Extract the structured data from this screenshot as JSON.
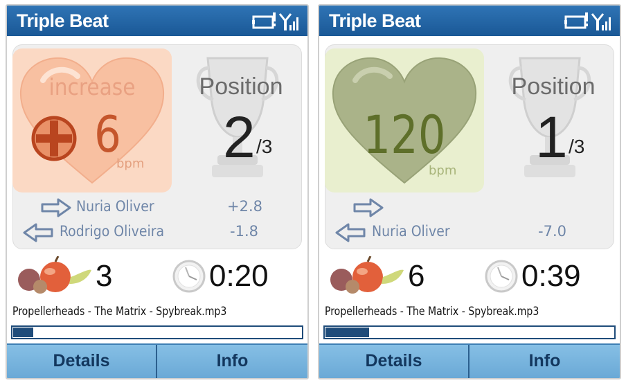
{
  "screens": [
    {
      "app_title": "Triple Beat",
      "heart": {
        "mode": "increase",
        "label": "increase",
        "value": "6",
        "unit": "bpm",
        "fill_color": "#fbd9c4"
      },
      "position": {
        "label": "Position",
        "current": "2",
        "of": "/3"
      },
      "competitors": [
        {
          "direction": "ahead",
          "name": "Nuria Oliver",
          "diff": "+2.8"
        },
        {
          "direction": "behind",
          "name": "Rodrigo Oliveira",
          "diff": "-1.8"
        }
      ],
      "fruit_count": "3",
      "elapsed_time": "0:20",
      "track_title": "Propellerheads - The Matrix - Spybreak.mp3",
      "progress_fraction": 0.07,
      "softkeys": {
        "left": "Details",
        "right": "Info"
      }
    },
    {
      "app_title": "Triple Beat",
      "heart": {
        "mode": "heart-rate",
        "label": "",
        "value": "120",
        "unit": "bpm",
        "fill_color": "#e9efcf"
      },
      "position": {
        "label": "Position",
        "current": "1",
        "of": "/3"
      },
      "competitors": [
        {
          "direction": "ahead",
          "name": "",
          "diff": ""
        },
        {
          "direction": "behind",
          "name": "Nuria Oliver",
          "diff": "-7.0"
        }
      ],
      "fruit_count": "6",
      "elapsed_time": "0:39",
      "track_title": "Propellerheads - The Matrix - Spybreak.mp3",
      "progress_fraction": 0.15,
      "softkeys": {
        "left": "Details",
        "right": "Info"
      }
    }
  ],
  "icons": {
    "status": [
      "battery-warning-icon",
      "signal-strength-icon"
    ],
    "heart": "heart-icon",
    "trophy": "trophy-icon",
    "arrow_right": "arrow-right-icon",
    "arrow_left": "arrow-left-icon",
    "fruit": "fruit-icon",
    "clock": "stopwatch-icon",
    "plus": "plus-circle-icon"
  },
  "colors": {
    "titlebar": "#1f5f9f",
    "softkey_bar": "#78b4dd",
    "competitor_text": "#6f86a8",
    "increase_text": "#c5562c",
    "heart_rate_text": "#5e6f2a"
  }
}
